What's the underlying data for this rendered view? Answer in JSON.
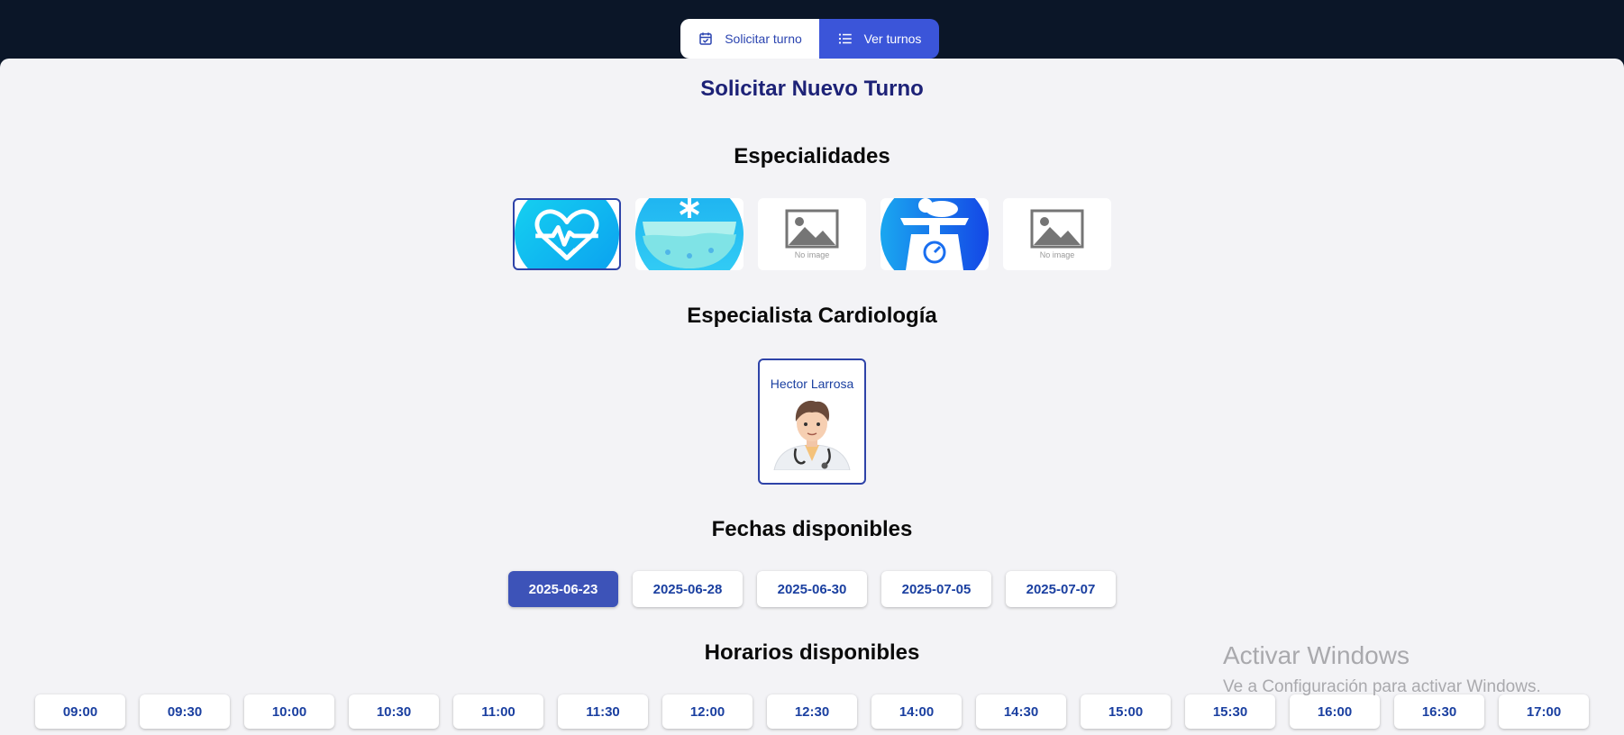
{
  "tabs": {
    "request_label": "Solicitar turno",
    "list_label": "Ver turnos"
  },
  "page": {
    "title": "Solicitar Nuevo Turno"
  },
  "specialties": {
    "heading": "Especialidades",
    "items": [
      {
        "icon": "heart-pulse-icon",
        "selected": true
      },
      {
        "icon": "bowl-snowflake-icon",
        "selected": false
      },
      {
        "icon": "no-image-placeholder",
        "placeholder_text": "No image",
        "selected": false
      },
      {
        "icon": "baby-scale-icon",
        "selected": false
      },
      {
        "icon": "no-image-placeholder",
        "placeholder_text": "No image",
        "selected": false
      }
    ]
  },
  "specialist": {
    "heading": "Especialista Cardiología",
    "doctors": [
      {
        "name": "Hector Larrosa"
      }
    ]
  },
  "dates": {
    "heading": "Fechas disponibles",
    "items": [
      "2025-06-23",
      "2025-06-28",
      "2025-06-30",
      "2025-07-05",
      "2025-07-07"
    ],
    "selected": "2025-06-23"
  },
  "times": {
    "heading": "Horarios disponibles",
    "items": [
      "09:00",
      "09:30",
      "10:00",
      "10:30",
      "11:00",
      "11:30",
      "12:00",
      "12:30",
      "14:00",
      "14:30",
      "15:00",
      "15:30",
      "16:00",
      "16:30",
      "17:00"
    ]
  },
  "watermark": {
    "title": "Activar Windows",
    "subtitle": "Ve a Configuración para activar Windows."
  },
  "colors": {
    "header_bg": "#0b1628",
    "accent": "#3b55d9",
    "selected_date": "#3d53b8",
    "page_bg": "#f3f3f6",
    "title": "#1d2277"
  }
}
